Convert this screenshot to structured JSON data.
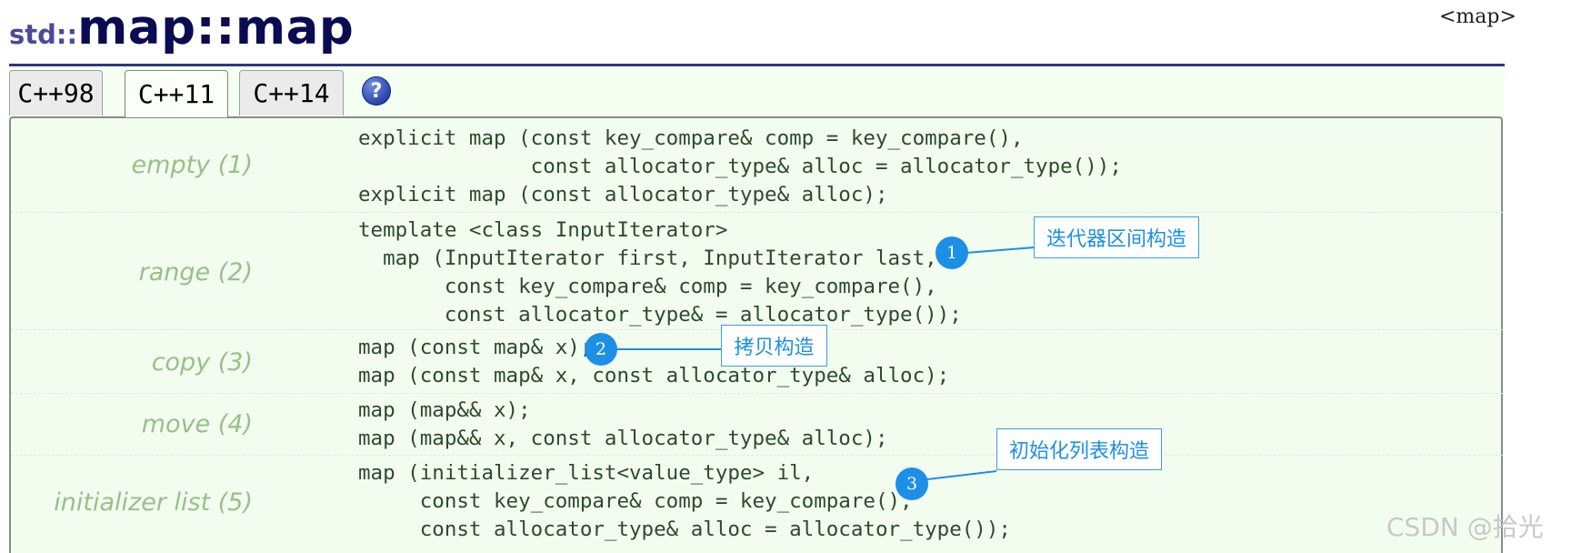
{
  "header": {
    "namespace": "std::",
    "title": "map::map",
    "library_tag": "<map>"
  },
  "tabs": [
    {
      "label": "C++98",
      "active": false
    },
    {
      "label": "C++11",
      "active": true
    },
    {
      "label": "C++14",
      "active": false
    }
  ],
  "help_icon": {
    "glyph": "?"
  },
  "constructors": [
    {
      "label": "empty (1)",
      "code": "explicit map (const key_compare& comp = key_compare(),\n              const allocator_type& alloc = allocator_type());\nexplicit map (const allocator_type& alloc);"
    },
    {
      "label": "range (2)",
      "code": "template <class InputIterator>\n  map (InputIterator first, InputIterator last,\n       const key_compare& comp = key_compare(),\n       const allocator_type& = allocator_type());"
    },
    {
      "label": "copy (3)",
      "code": "map (const map& x);\nmap (const map& x, const allocator_type& alloc);"
    },
    {
      "label": "move (4)",
      "code": "map (map&& x);\nmap (map&& x, const allocator_type& alloc);"
    },
    {
      "label": "initializer list (5)",
      "code": "map (initializer_list<value_type> il,\n     const key_compare& comp = key_compare(),\n     const allocator_type& alloc = allocator_type());"
    }
  ],
  "annotations": [
    {
      "number": "1",
      "text": "迭代器区间构造"
    },
    {
      "number": "2",
      "text": "拷贝构造"
    },
    {
      "number": "3",
      "text": "初始化列表构造"
    }
  ],
  "watermark": "CSDN @拾光",
  "colors": {
    "title_dark": "#0b0b52",
    "namespace": "#4a4a9a",
    "panel_bg": "#f2fdf0",
    "label_green": "#98c088",
    "code_text": "#2e4a2e",
    "callout_blue": "#1d8fe6",
    "rule": "#2a3a7a"
  }
}
